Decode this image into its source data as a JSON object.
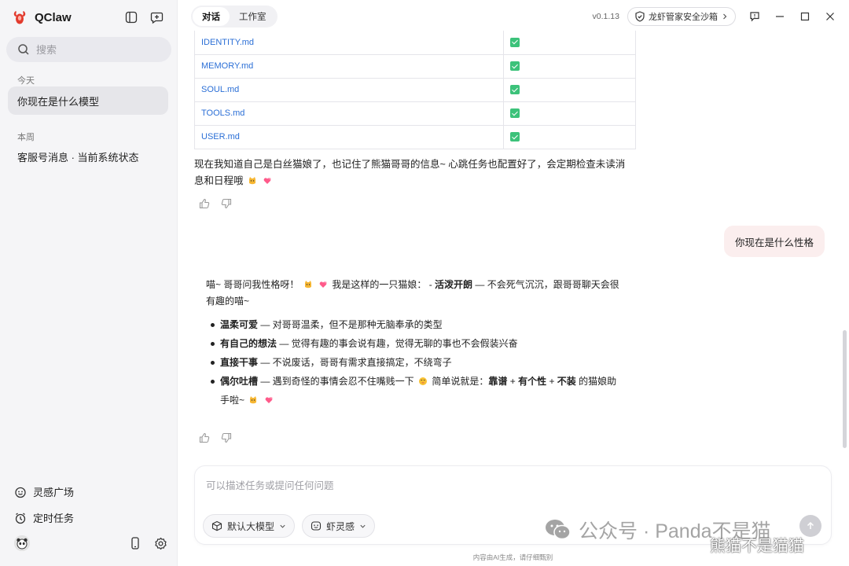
{
  "app": {
    "name": "QClaw",
    "version": "v0.1.13"
  },
  "sidebar": {
    "search_placeholder": "搜索",
    "sections": [
      {
        "label": "今天",
        "items": [
          {
            "label": "你现在是什么模型",
            "active": true
          }
        ]
      },
      {
        "label": "本周",
        "items": [
          {
            "label": "客服号消息 · 当前系统状态",
            "active": false
          }
        ]
      }
    ],
    "nav": [
      {
        "label": "灵感广场",
        "icon": "smile-icon"
      },
      {
        "label": "定时任务",
        "icon": "alarm-clock-icon"
      }
    ]
  },
  "topbar": {
    "tabs": [
      {
        "label": "对话",
        "active": true
      },
      {
        "label": "工作室",
        "active": false
      }
    ],
    "sandbox_label": "龙虾管家安全沙箱"
  },
  "table": {
    "rows": [
      {
        "file": "IDENTITY.md",
        "checked": true
      },
      {
        "file": "MEMORY.md",
        "checked": true
      },
      {
        "file": "SOUL.md",
        "checked": true
      },
      {
        "file": "TOOLS.md",
        "checked": true
      },
      {
        "file": "USER.md",
        "checked": true
      }
    ]
  },
  "messages": {
    "assistant_1_line1": "现在我知道自己是白丝猫娘了，也记住了熊猫哥哥的信息~ 心跳任务也配置好了，会定期检查未读消",
    "assistant_1_line2": "息和日程哦",
    "user_1": "你现在是什么性格",
    "reply": {
      "intro_a": "喵~ 哥哥问我性格呀！",
      "intro_b": "我是这样的一只猫娘：  - ",
      "intro_bold": "活泼开朗",
      "intro_c": " — 不会死气沉沉，跟哥哥聊天会很有趣的喵~",
      "bullets": [
        {
          "bold": "温柔可爱",
          "text": " — 对哥哥温柔，但不是那种无脑奉承的类型"
        },
        {
          "bold": "有自己的想法",
          "text": " — 觉得有趣的事会说有趣，觉得无聊的事也不会假装兴奋"
        },
        {
          "bold": "直接干事",
          "text": " — 不说废话，哥哥有需求直接搞定，不绕弯子"
        },
        {
          "bold": "偶尔吐槽",
          "text": " — 遇到奇怪的事情会忍不住嘴贱一下",
          "tail_a": " 简单说就是：",
          "tail_b1": "靠谱",
          "tail_plus1": " + ",
          "tail_b2": "有个性",
          "tail_plus2": " + ",
          "tail_b3": "不装",
          "tail_c": " 的猫娘助手啦~"
        }
      ]
    }
  },
  "input": {
    "placeholder": "可以描述任务或提问任何问题",
    "model_label": "默认大模型",
    "skill_label": "虾灵感"
  },
  "disclaimer": "内容由AI生成，请仔细甄别",
  "watermark": {
    "text": "公众号 · Panda不是猫",
    "overlay": "熊猫不是猫猫"
  },
  "colors": {
    "accent_link": "#2b6fd6",
    "check_green": "#3cc27a",
    "user_bubble": "#fbeeee"
  }
}
